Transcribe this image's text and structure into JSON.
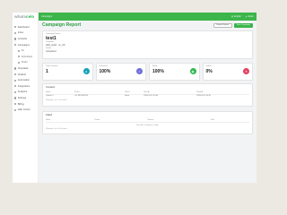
{
  "brand": {
    "logo_part1": "whats",
    "logo_part2": "cel",
    "logo_suffix": "o"
  },
  "sidebar": {
    "items": [
      {
        "label": "Dashboard",
        "sub": false
      },
      {
        "label": "Inbox",
        "sub": false
      },
      {
        "label": "Contacts",
        "sub": false
      },
      {
        "label": "Campaigns",
        "sub": false
      },
      {
        "label": "All",
        "sub": true
      },
      {
        "label": "Scheduled",
        "sub": true
      },
      {
        "label": "Drafts",
        "sub": true
      },
      {
        "label": "Templates",
        "sub": false
      },
      {
        "label": "Chatbot",
        "sub": false
      },
      {
        "label": "Automation",
        "sub": false
      },
      {
        "label": "Integrations",
        "sub": false
      },
      {
        "label": "Analytics",
        "sub": false
      },
      {
        "label": "Settings",
        "sub": false
      },
      {
        "label": "Billing",
        "sub": false
      },
      {
        "label": "Help Center",
        "sub": false
      }
    ]
  },
  "topbar": {
    "left": "Campaigns",
    "user": "Admin",
    "lang": "English"
  },
  "page": {
    "title": "Campaign Report",
    "btn_export": "Export Report",
    "btn_new": "New Campaign"
  },
  "info": {
    "campaign_label": "Campaign Name",
    "campaign_name": "test1",
    "template_label": "Template",
    "template_value": "hello_world · en_US",
    "status_label": "Status",
    "status_value": "Completed"
  },
  "stats": [
    {
      "label": "Total Contacts",
      "value": "1",
      "color": "#17a2b8",
      "icon": "users-icon",
      "glyph": "●"
    },
    {
      "label": "Delivered",
      "value": "100%",
      "color": "#6f6fd8",
      "icon": "check-icon",
      "glyph": "✓"
    },
    {
      "label": "Read",
      "value": "100%",
      "color": "#2eb84f",
      "icon": "eye-icon",
      "glyph": "◉"
    },
    {
      "label": "Failed",
      "value": "0%",
      "color": "#e4405f",
      "icon": "close-icon",
      "glyph": "✕"
    }
  ],
  "table1": {
    "title": "Contacts",
    "headers": [
      "Name",
      "Phone",
      "Status",
      "Sent At",
      "Read At"
    ],
    "rows": [
      [
        "Contact 1",
        "+91 9876543210",
        "Read",
        "2024-01-15 10:30",
        "2024-01-15 10:35"
      ]
    ],
    "footer": "Showing 1 to 1 of 1 entries"
  },
  "table2": {
    "title": "Failed",
    "headers": [
      "Name",
      "Phone",
      "Reason",
      "Date"
    ],
    "empty": "No data available in table",
    "footer": "Showing 0 to 0 of 0 entries"
  }
}
